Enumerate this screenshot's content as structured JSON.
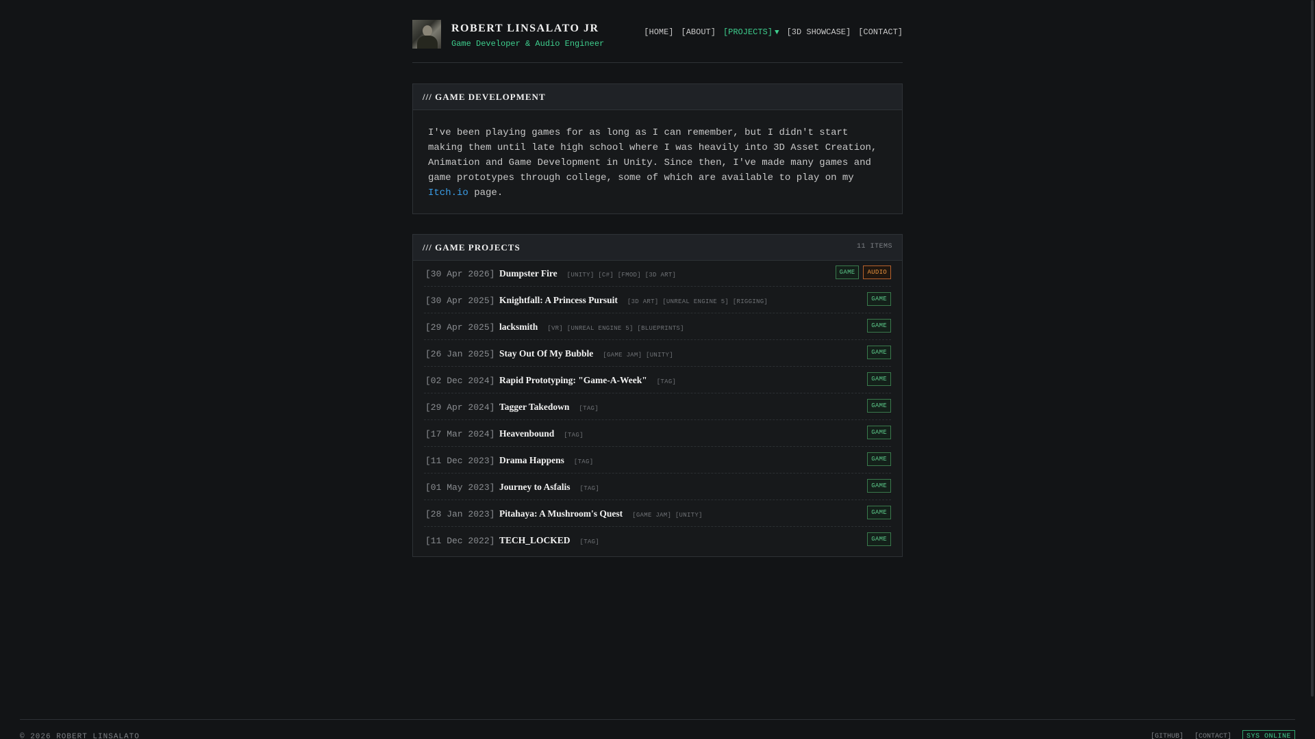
{
  "header": {
    "site_name": "ROBERT LINSALATO JR",
    "subtitle": "Game Developer & Audio Engineer",
    "nav": [
      {
        "label": "[HOME]",
        "active": false
      },
      {
        "label": "[ABOUT]",
        "active": false
      },
      {
        "label": "[PROJECTS]",
        "active": true
      },
      {
        "label": "[3D SHOWCASE]",
        "active": false
      },
      {
        "label": "[CONTACT]",
        "active": false
      }
    ],
    "caret": "▼"
  },
  "intro": {
    "title": "/// GAME DEVELOPMENT",
    "text_before_link": "I've been playing games for as long as I can remember, but I didn't start making them until late high school where I was heavily into 3D Asset Creation, Animation and Game Development in Unity. Since then, I've made many games and game prototypes through college, some of which are available to play on my ",
    "link_text": "Itch.io",
    "text_after_link": " page."
  },
  "projects": {
    "title": "/// GAME PROJECTS",
    "count": "11 ITEMS",
    "items": [
      {
        "date": "[30 Apr 2026]",
        "name": "Dumpster Fire",
        "tags": "[UNITY] [C#] [FMOD] [3D ART]",
        "badges": [
          "GAME",
          "AUDIO"
        ]
      },
      {
        "date": "[30 Apr 2025]",
        "name": "Knightfall: A Princess Pursuit",
        "tags": "[3D ART] [UNREAL ENGINE 5] [RIGGING]",
        "badges": [
          "GAME"
        ]
      },
      {
        "date": "[29 Apr 2025]",
        "name": "lacksmith",
        "tags": "[VR] [UNREAL ENGINE 5] [BLUEPRINTS]",
        "badges": [
          "GAME"
        ]
      },
      {
        "date": "[26 Jan 2025]",
        "name": "Stay Out Of My Bubble",
        "tags": "[GAME JAM] [UNITY]",
        "badges": [
          "GAME"
        ]
      },
      {
        "date": "[02 Dec 2024]",
        "name": "Rapid Prototyping: \"Game-A-Week\"",
        "tags": "[TAG]",
        "badges": [
          "GAME"
        ]
      },
      {
        "date": "[29 Apr 2024]",
        "name": "Tagger Takedown",
        "tags": "[TAG]",
        "badges": [
          "GAME"
        ]
      },
      {
        "date": "[17 Mar 2024]",
        "name": "Heavenbound",
        "tags": "[TAG]",
        "badges": [
          "GAME"
        ]
      },
      {
        "date": "[11 Dec 2023]",
        "name": "Drama Happens",
        "tags": "[TAG]",
        "badges": [
          "GAME"
        ]
      },
      {
        "date": "[01 May 2023]",
        "name": "Journey to Asfalis",
        "tags": "[TAG]",
        "badges": [
          "GAME"
        ]
      },
      {
        "date": "[28 Jan 2023]",
        "name": "Pitahaya: A Mushroom's Quest",
        "tags": "[GAME JAM] [UNITY]",
        "badges": [
          "GAME"
        ]
      },
      {
        "date": "[11 Dec 2022]",
        "name": "TECH_LOCKED",
        "tags": "[TAG]",
        "badges": [
          "GAME"
        ]
      }
    ]
  },
  "footer": {
    "copyright": "© 2026 ROBERT LINSALATO",
    "links": [
      "[GITHUB]",
      "[CONTACT]"
    ],
    "status": "SYS ONLINE"
  },
  "colors": {
    "background": "#121416",
    "accent": "#3ecf8e",
    "link": "#3a9ee8",
    "audio_badge": "#e8923c"
  }
}
